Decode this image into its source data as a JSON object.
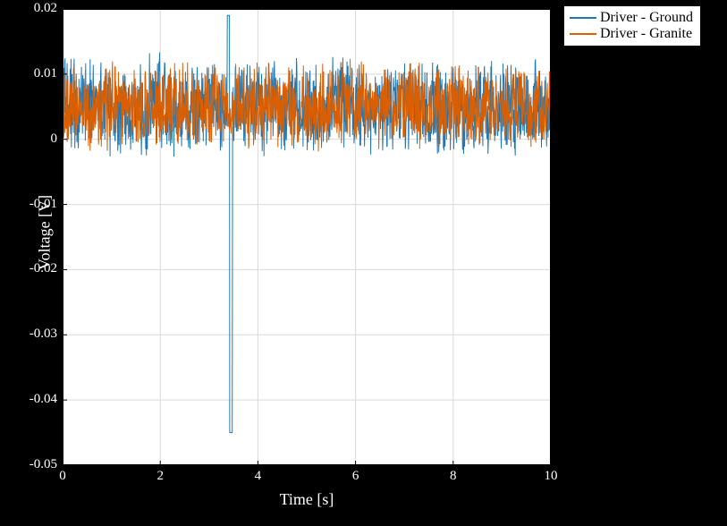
{
  "chart_data": {
    "type": "line",
    "title": "",
    "xlabel": "Time [s]",
    "ylabel": "Voltage [V]",
    "xlim": [
      0,
      10
    ],
    "ylim": [
      -0.05,
      0.02
    ],
    "xticks": [
      0,
      2,
      4,
      6,
      8,
      10
    ],
    "yticks": [
      -0.05,
      -0.04,
      -0.03,
      -0.02,
      -0.01,
      0,
      0.01,
      0.02
    ],
    "xtick_labels": [
      "0",
      "2",
      "4",
      "6",
      "8",
      "10"
    ],
    "ytick_labels": [
      "-0.05",
      "-0.04",
      "-0.03",
      "-0.02",
      "-0.01",
      "0",
      "0.01",
      "0.02"
    ],
    "legend_position": "outside-top-right",
    "grid": true,
    "series": [
      {
        "name": "Driver - Ground",
        "color": "#1f77b4",
        "noise_center": 0.005,
        "noise_amp": 0.008,
        "spikes": [
          {
            "x": 3.4,
            "y": 0.019
          },
          {
            "x": 3.45,
            "y": -0.045
          }
        ]
      },
      {
        "name": "Driver - Granite",
        "color": "#d95f02",
        "noise_center": 0.005,
        "noise_amp": 0.007,
        "spikes": []
      }
    ],
    "annotations": []
  },
  "legend": {
    "items": [
      "Driver - Ground",
      "Driver - Granite"
    ]
  },
  "axis": {
    "xlabel": "Time [s]",
    "ylabel": "Voltage [V]"
  }
}
